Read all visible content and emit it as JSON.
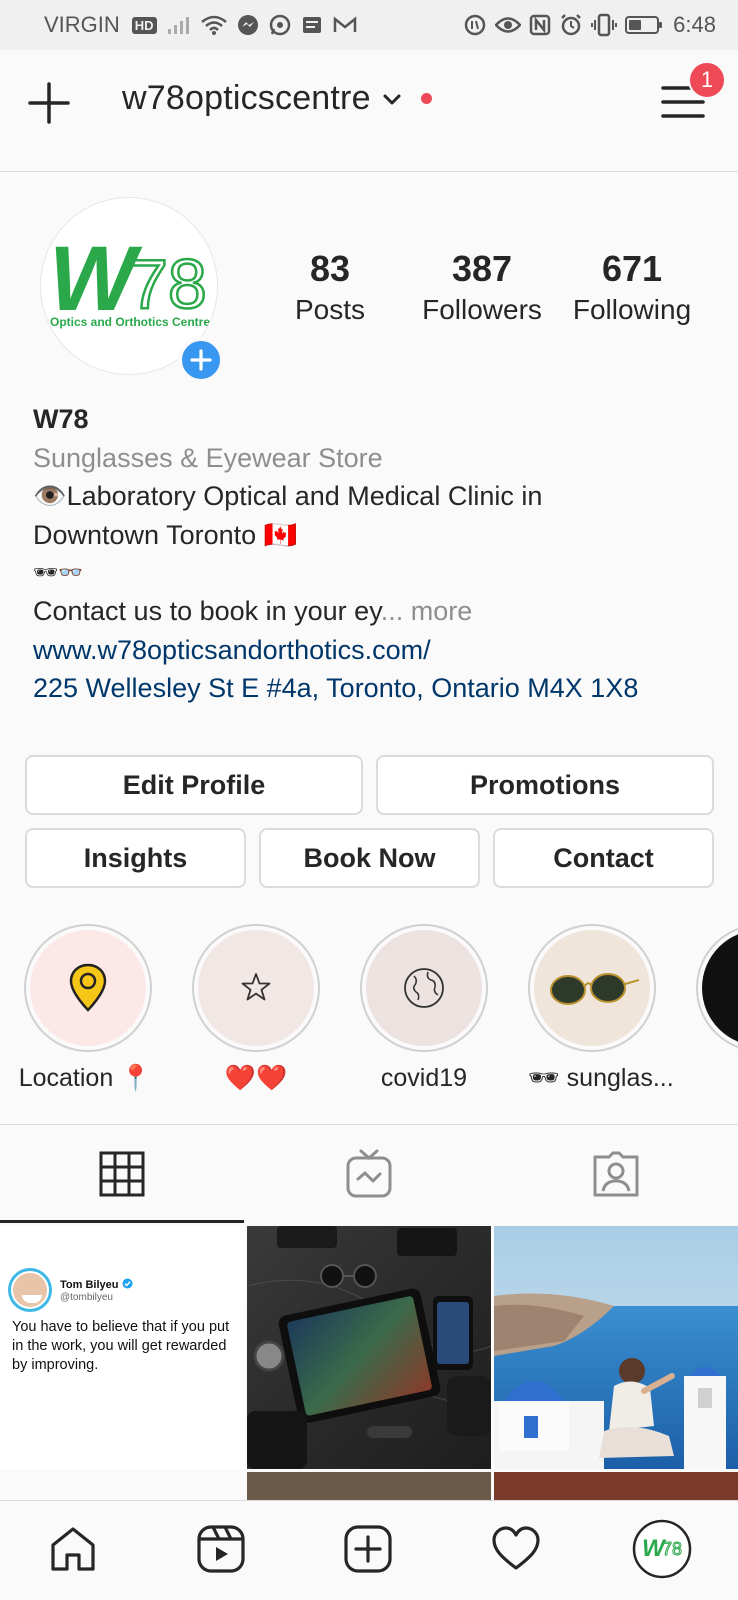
{
  "status_bar": {
    "carrier": "VIRGIN",
    "network_badge": "HD",
    "time": "6:48",
    "battery_level": 0.45
  },
  "header": {
    "username": "w78opticscentre",
    "notification_count": "1"
  },
  "profile": {
    "avatar_logo_text": "W78",
    "avatar_logo_subtext": "Optics and Orthotics Centre",
    "stats": [
      {
        "value": "83",
        "label": "Posts"
      },
      {
        "value": "387",
        "label": "Followers"
      },
      {
        "value": "671",
        "label": "Following"
      }
    ],
    "name": "W78",
    "category": "Sunglasses & Eyewear Store",
    "bio_line1": "👁️Laboratory Optical and Medical Clinic in",
    "bio_line2": "Downtown Toronto 🇨🇦",
    "bio_line3": "🕶👓",
    "bio_line4": "Contact us to book in your ey",
    "bio_more": "... more",
    "website": "www.w78opticsandorthotics.com/",
    "address": "225 Wellesley St E #4a, Toronto, Ontario M4X 1X8"
  },
  "buttons": {
    "edit_profile": "Edit Profile",
    "promotions": "Promotions",
    "insights": "Insights",
    "book_now": "Book Now",
    "contact": "Contact"
  },
  "highlights": [
    {
      "label": "Location 📍",
      "icon": "location-pin-icon",
      "bg": "#fde8e8"
    },
    {
      "label": "❤️❤️",
      "icon": "star-icon",
      "bg": "#f1e7e4"
    },
    {
      "label": "covid19",
      "icon": "globe-icon",
      "bg": "#ece2e0"
    },
    {
      "label": "🕶 sunglas...",
      "icon": "sunglasses-icon",
      "bg": "#efe5da"
    }
  ],
  "tabs": [
    {
      "icon": "grid-icon",
      "active": true
    },
    {
      "icon": "igtv-icon",
      "active": false
    },
    {
      "icon": "tagged-icon",
      "active": false
    }
  ],
  "posts": {
    "tweet_author": "Tom Bilyeu",
    "tweet_handle": "@tombilyeu",
    "tweet_text": "You have to believe that if you put in the work, you will get rewarded by improving."
  },
  "bottom_nav": [
    {
      "icon": "home-icon"
    },
    {
      "icon": "reels-icon"
    },
    {
      "icon": "new-post-icon"
    },
    {
      "icon": "activity-heart-icon"
    },
    {
      "icon": "profile-avatar-icon"
    }
  ],
  "colors": {
    "accent_blue": "#3897f0",
    "badge_red": "#ed4956",
    "link": "#00376b",
    "logo_green": "#2aa84a"
  }
}
